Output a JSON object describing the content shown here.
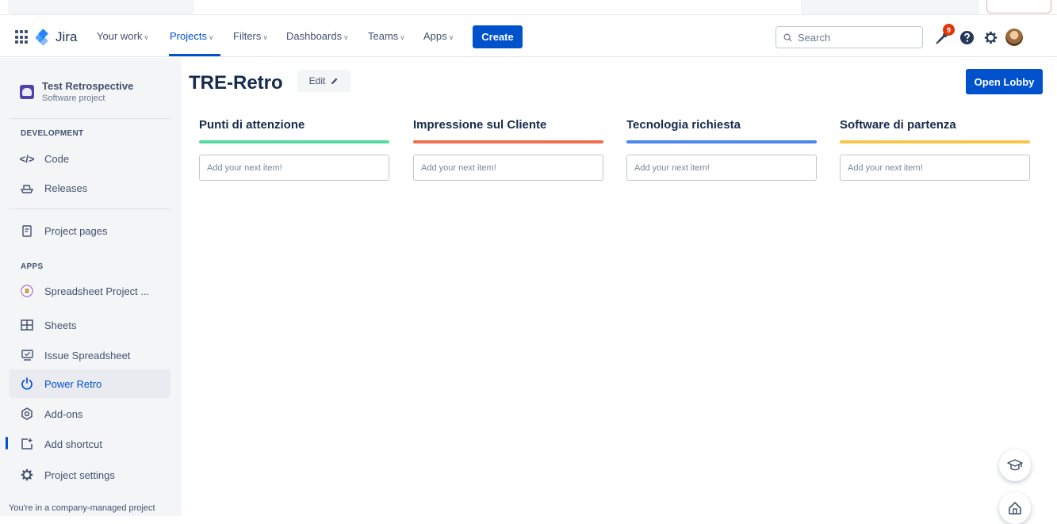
{
  "nav": {
    "logo": "Jira",
    "items": [
      {
        "label": "Your work",
        "chevron": "v"
      },
      {
        "label": "Projects",
        "chevron": "v"
      },
      {
        "label": "Filters",
        "chevron": "v"
      },
      {
        "label": "Dashboards",
        "chevron": "v"
      },
      {
        "label": "Teams",
        "chevron": "v"
      },
      {
        "label": "Apps",
        "chevron": "v"
      }
    ],
    "create": "Create",
    "search_placeholder": "Search",
    "notifications_count": "9"
  },
  "sidebar": {
    "project_name": "Test Retrospective",
    "project_type": "Software project",
    "section_dev": "DEVELOPMENT",
    "code": "Code",
    "releases": "Releases",
    "project_pages": "Project pages",
    "section_apps": "APPS",
    "spreadsheet_project": "Spreadsheet Project ...",
    "sheets": "Sheets",
    "issue_spreadsheet": "Issue Spreadsheet",
    "power_retro": "Power Retro",
    "add_ons": "Add-ons",
    "add_shortcut": "Add shortcut",
    "project_settings": "Project settings",
    "footer": "You're in a company-managed project"
  },
  "main": {
    "title": "TRE-Retro",
    "edit": "Edit",
    "open_lobby": "Open Lobby",
    "columns": [
      {
        "title": "Punti di attenzione",
        "color": "#57d9a3",
        "placeholder": "Add your next item!"
      },
      {
        "title": "Impressione sul Cliente",
        "color": "#f06e4f",
        "placeholder": "Add your next item!"
      },
      {
        "title": "Tecnologia richiesta",
        "color": "#4c86ef",
        "placeholder": "Add your next item!"
      },
      {
        "title": "Software di partenza",
        "color": "#f6c64a",
        "placeholder": "Add your next item!"
      }
    ]
  },
  "colors": {
    "brand": "#0052cc",
    "sidebar_bg": "#f4f5f7"
  }
}
